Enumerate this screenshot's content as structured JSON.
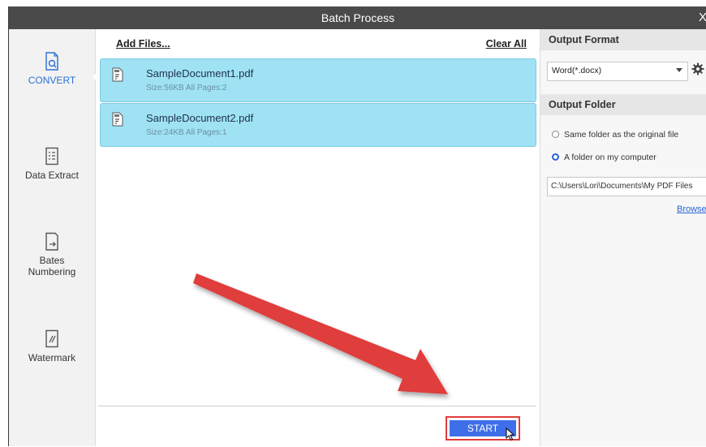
{
  "window": {
    "title": "Batch Process",
    "close_glyph": "X"
  },
  "sidebar": {
    "items": [
      {
        "label": "CONVERT",
        "icon": "convert-icon",
        "active": true
      },
      {
        "label": "Data Extract",
        "icon": "data-extract-icon",
        "active": false
      },
      {
        "label": "Bates Numbering",
        "label_line1": "Bates",
        "label_line2": "Numbering",
        "icon": "bates-numbering-icon",
        "active": false
      },
      {
        "label": "Watermark",
        "icon": "watermark-icon",
        "active": false
      }
    ]
  },
  "files_toolbar": {
    "add_files": "Add Files...",
    "clear_all": "Clear All"
  },
  "files": [
    {
      "name": "SampleDocument1.pdf",
      "meta": "Size:56KB  All Pages:2",
      "icon": "pdf-file-icon"
    },
    {
      "name": "SampleDocument2.pdf",
      "meta": "Size:24KB  All Pages:1",
      "icon": "pdf-file-icon"
    }
  ],
  "output_format": {
    "heading": "Output Format",
    "selected": "Word(*.docx)",
    "settings_icon": "gear-icon"
  },
  "output_folder": {
    "heading": "Output Folder",
    "options": [
      {
        "label": "Same folder as the original file",
        "selected": false
      },
      {
        "label": "A folder on my computer",
        "selected": true
      }
    ],
    "path": "C:\\Users\\Lori\\Documents\\My PDF Files",
    "browse": "Browse"
  },
  "actions": {
    "start": "START"
  },
  "colors": {
    "accent": "#3f6fe8",
    "file_row_bg": "#9fe2f3",
    "annotation_red": "#e03c3c",
    "titlebar": "#4a4a4a"
  }
}
